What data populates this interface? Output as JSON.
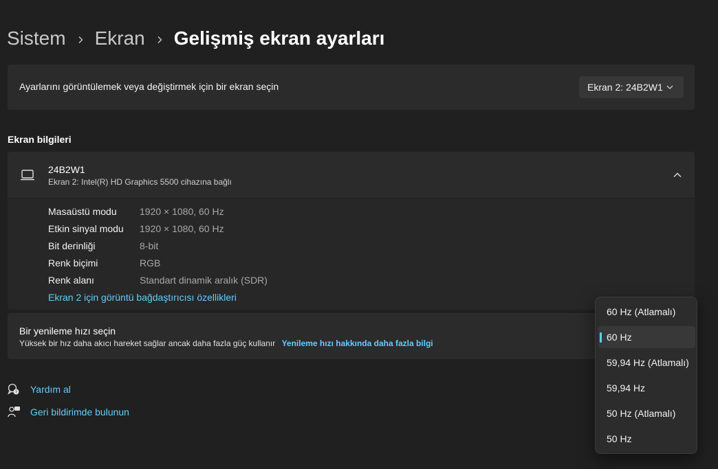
{
  "breadcrumb": {
    "items": [
      "Sistem",
      "Ekran"
    ],
    "current": "Gelişmiş ekran ayarları"
  },
  "display_select": {
    "label": "Ayarlarını görüntülemek veya değiştirmek için bir ekran seçin",
    "selected": "Ekran 2: 24B2W1"
  },
  "display_info": {
    "section_title": "Ekran bilgileri",
    "name": "24B2W1",
    "subtitle": "Ekran 2: Intel(R) HD Graphics 5500 cihazına bağlı",
    "rows": [
      {
        "key": "Masaüstü modu",
        "value": "1920 × 1080, 60 Hz"
      },
      {
        "key": "Etkin sinyal modu",
        "value": "1920 × 1080, 60 Hz"
      },
      {
        "key": "Bit derinliği",
        "value": "8-bit"
      },
      {
        "key": "Renk biçimi",
        "value": "RGB"
      },
      {
        "key": "Renk alanı",
        "value": "Standart dinamik aralık (SDR)"
      }
    ],
    "adapter_link": "Ekran 2 için görüntü bağdaştırıcısı özellikleri"
  },
  "refresh": {
    "title": "Bir yenileme hızı seçin",
    "description": "Yüksek bir hız daha akıcı hareket sağlar ancak daha fazla güç kullanır",
    "link": "Yenileme hızı hakkında daha fazla bilgi",
    "options": [
      "60 Hz (Atlamalı)",
      "60 Hz",
      "59,94 Hz (Atlamalı)",
      "59,94 Hz",
      "50 Hz (Atlamalı)",
      "50 Hz"
    ],
    "selected_index": 1
  },
  "help": {
    "get_help": "Yardım al",
    "feedback": "Geri bildirimde bulunun"
  },
  "colors": {
    "background": "#202020",
    "card": "#2b2b2b",
    "accent": "#60cdff"
  }
}
